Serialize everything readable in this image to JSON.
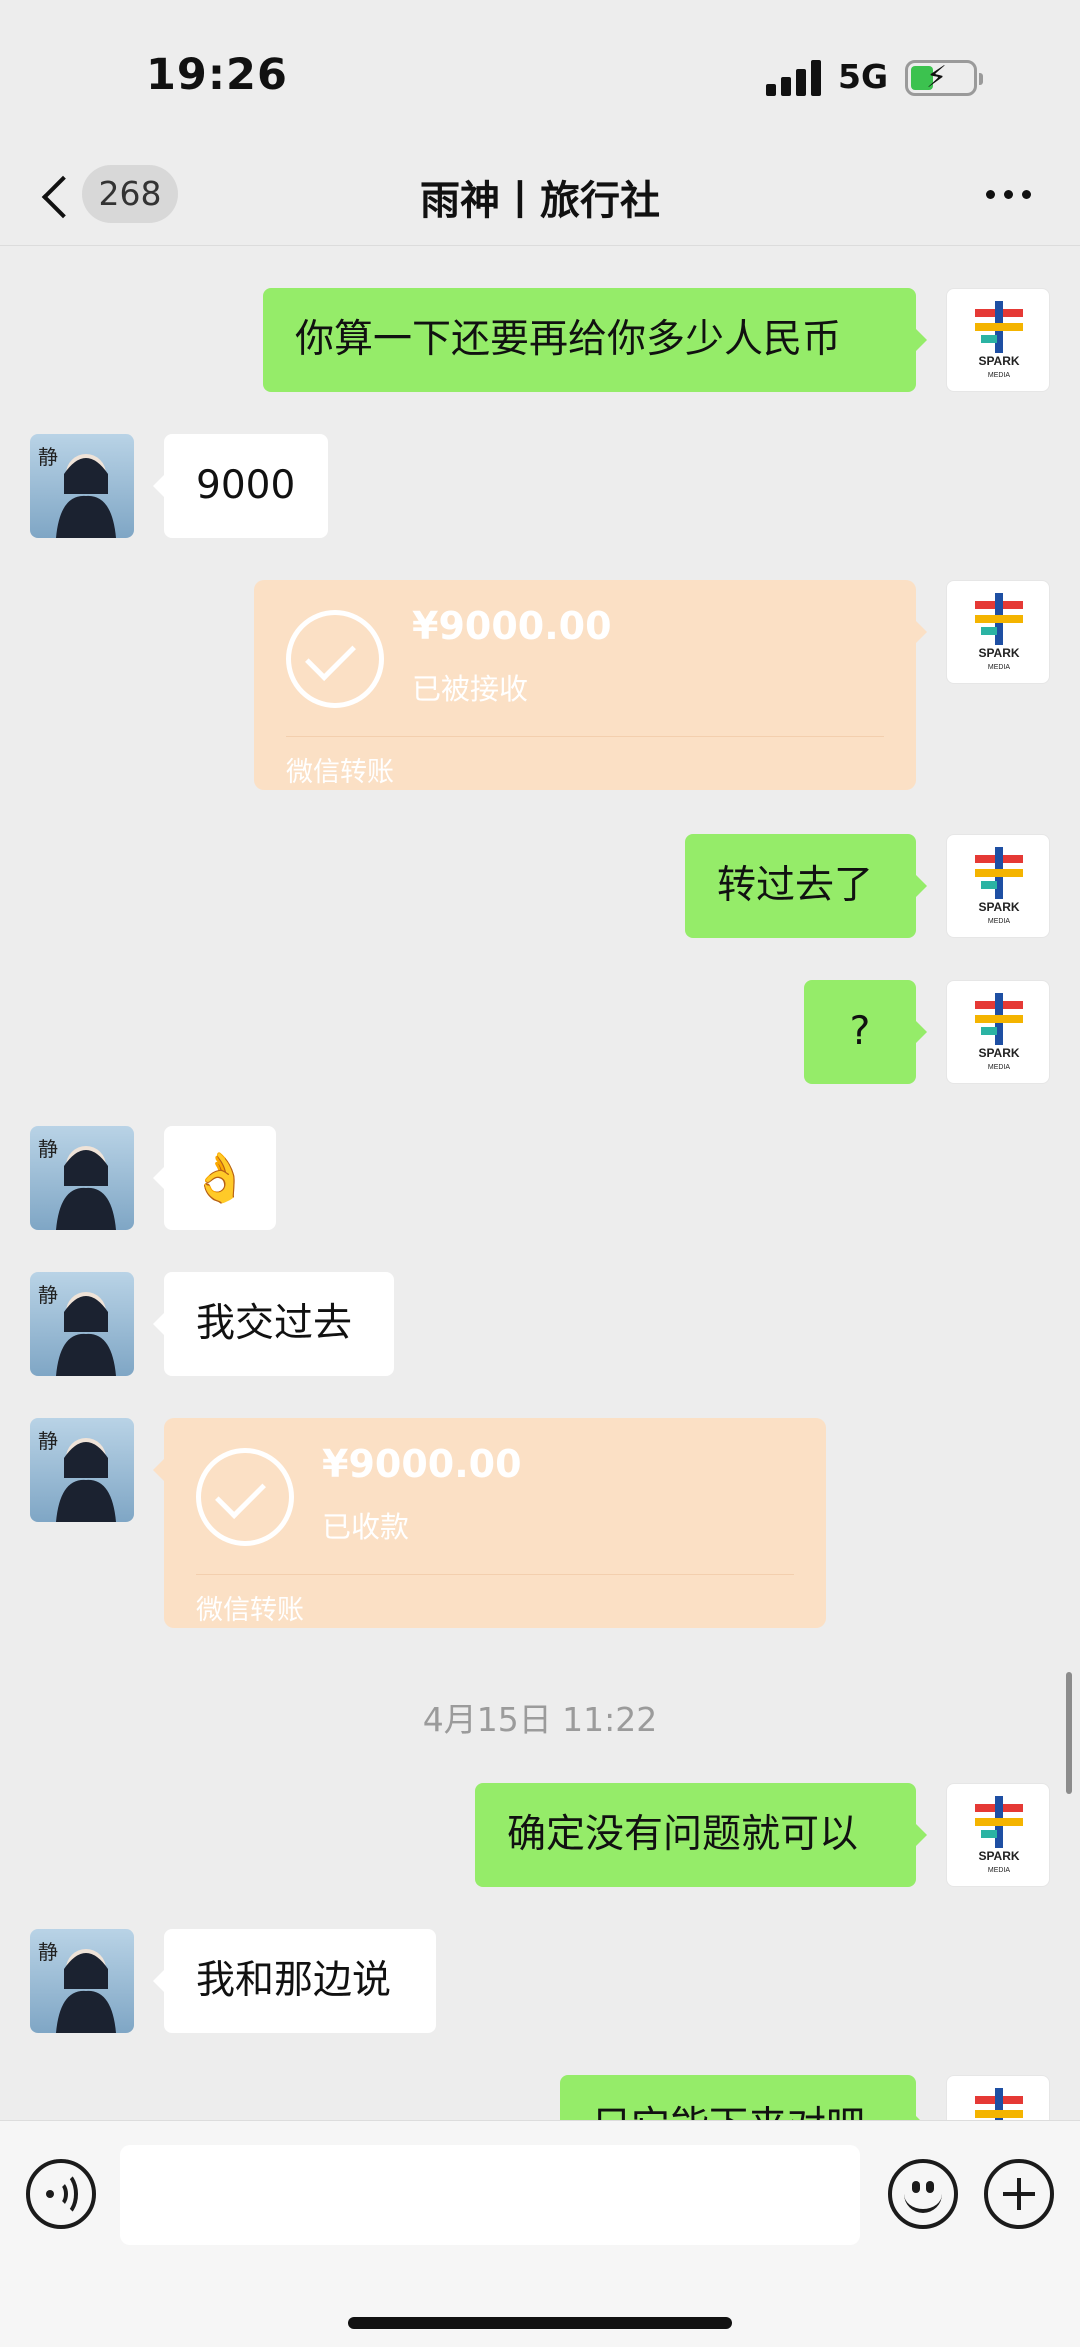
{
  "status_bar": {
    "time": "19:26",
    "network": "5G",
    "icons": [
      "signal-icon",
      "battery-charging-icon"
    ]
  },
  "nav": {
    "back_icon": "chevron-left-icon",
    "unread_count": "268",
    "title": "雨神丨旅行社",
    "more_icon": "more-dots-icon"
  },
  "colors": {
    "my_bubble": "#95ec69",
    "other_bubble": "#ffffff",
    "transfer_card": "#fbe0c5",
    "background": "#ededed"
  },
  "messages": [
    {
      "from": "me",
      "type": "text",
      "text": "你算一下还要再给你多少人民币"
    },
    {
      "from": "other",
      "type": "text",
      "text": "9000"
    },
    {
      "from": "me",
      "type": "transfer",
      "amount": "¥9000.00",
      "status": "已被接收",
      "label": "微信转账"
    },
    {
      "from": "me",
      "type": "text",
      "text": "转过去了"
    },
    {
      "from": "me",
      "type": "text",
      "text": "?"
    },
    {
      "from": "other",
      "type": "emoji",
      "text": "👌"
    },
    {
      "from": "other",
      "type": "text",
      "text": "我交过去"
    },
    {
      "from": "other",
      "type": "transfer",
      "amount": "¥9000.00",
      "status": "已收款",
      "label": "微信转账"
    },
    {
      "type": "timestamp",
      "text": "4月15日 11:22"
    },
    {
      "from": "me",
      "type": "text",
      "text": "确定没有问题就可以"
    },
    {
      "from": "other",
      "type": "text",
      "text": "我和那边说"
    },
    {
      "from": "me",
      "type": "text",
      "text": "只它能下来对吧"
    }
  ],
  "input_bar": {
    "voice_icon": "voice-icon",
    "emoji_icon": "emoji-icon",
    "plus_icon": "plus-icon"
  }
}
